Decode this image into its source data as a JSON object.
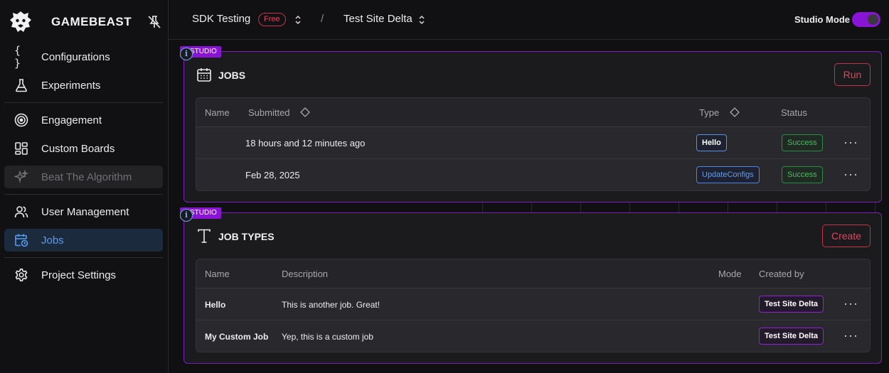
{
  "brand": {
    "name": "GAMEBEAST"
  },
  "sidebar": {
    "items": [
      {
        "label": "Configurations",
        "icon": "braces-icon"
      },
      {
        "label": "Experiments",
        "icon": "flask-icon"
      },
      {
        "label": "Engagement",
        "icon": "target-icon"
      },
      {
        "label": "Custom Boards",
        "icon": "dashboard-icon"
      },
      {
        "label": "Beat The Algorithm",
        "icon": "sparkle-icon",
        "disabled": true
      },
      {
        "label": "User Management",
        "icon": "users-icon"
      },
      {
        "label": "Jobs",
        "icon": "calendar-clock-icon",
        "active": true
      },
      {
        "label": "Project Settings",
        "icon": "gear-icon"
      }
    ]
  },
  "topbar": {
    "project": "SDK Testing",
    "plan_badge": "Free",
    "separator": "/",
    "site": "Test Site Delta",
    "studio_mode_label": "Studio Mode",
    "studio_mode_on": true
  },
  "jobs_panel": {
    "tag": "STUDIO",
    "title": "JOBS",
    "run_label": "Run",
    "columns": {
      "name": "Name",
      "submitted": "Submitted",
      "type": "Type",
      "status": "Status"
    },
    "rows": [
      {
        "name": "",
        "submitted": "18 hours and 12 minutes ago",
        "type": "Hello",
        "status": "Success",
        "actions": "···"
      },
      {
        "name": "",
        "submitted": "Feb 28, 2025",
        "type": "UpdateConfigs",
        "status": "Success",
        "actions": "···"
      }
    ]
  },
  "job_types_panel": {
    "tag": "STUDIO",
    "title": "JOB TYPES",
    "create_label": "Create",
    "columns": {
      "name": "Name",
      "description": "Description",
      "mode": "Mode",
      "created_by": "Created by"
    },
    "rows": [
      {
        "name": "Hello",
        "description": "This is another job. Great!",
        "mode": "",
        "created_by": "Test Site Delta",
        "actions": "···"
      },
      {
        "name": "My Custom Job",
        "description": "Yep, this is a custom job",
        "mode": "",
        "created_by": "Test Site Delta",
        "actions": "···"
      }
    ]
  },
  "colors": {
    "accent_purple": "#8a14d6",
    "danger": "#e0455d",
    "active_blue": "#5a9cf2",
    "success": "#4fba66"
  }
}
